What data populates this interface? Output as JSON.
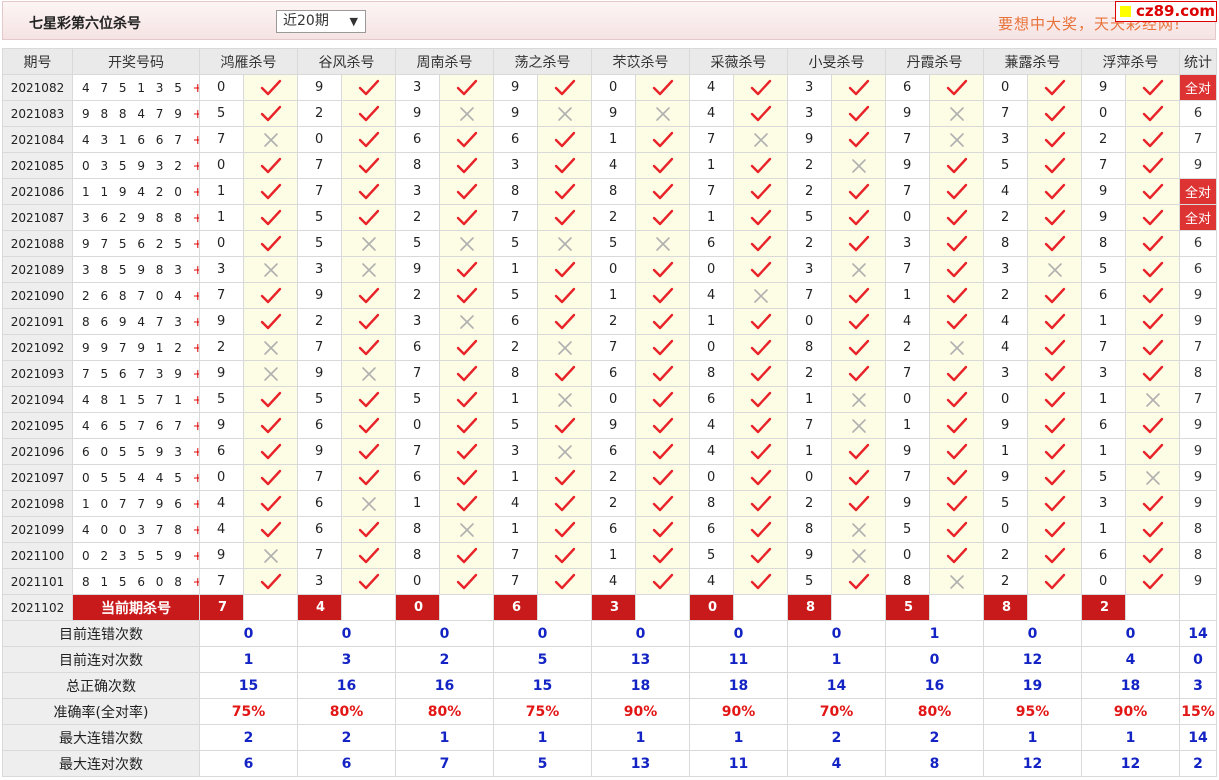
{
  "header": {
    "title": "七星彩第六位杀号",
    "period_select": "近20期",
    "slogan": "要想中大奖，天天彩经网!",
    "logo": "cz89.com"
  },
  "columns": {
    "period": "期号",
    "draw": "开奖号码",
    "experts": [
      "鸿雁杀号",
      "谷风杀号",
      "周南杀号",
      "荡之杀号",
      "芣苡杀号",
      "采薇杀号",
      "小旻杀号",
      "丹霞杀号",
      "蒹露杀号",
      "浮萍杀号"
    ],
    "stat": "统计"
  },
  "rows": [
    {
      "period": "2021082",
      "draw": "4 7 5 1 3 5",
      "plus": "+5",
      "kills": [
        0,
        9,
        3,
        9,
        0,
        4,
        3,
        6,
        0,
        9
      ],
      "ok": [
        1,
        1,
        1,
        1,
        1,
        1,
        1,
        1,
        1,
        1
      ],
      "stat": "全对"
    },
    {
      "period": "2021083",
      "draw": "9 8 8 4 7 9",
      "plus": "+13",
      "kills": [
        5,
        2,
        9,
        9,
        9,
        4,
        3,
        9,
        7,
        0
      ],
      "ok": [
        1,
        1,
        0,
        0,
        0,
        1,
        1,
        0,
        1,
        1
      ],
      "stat": "6"
    },
    {
      "period": "2021084",
      "draw": "4 3 1 6 6 7",
      "plus": "+0",
      "kills": [
        7,
        0,
        6,
        6,
        1,
        7,
        9,
        7,
        3,
        2
      ],
      "ok": [
        0,
        1,
        1,
        1,
        1,
        0,
        1,
        0,
        1,
        1
      ],
      "stat": "7"
    },
    {
      "period": "2021085",
      "draw": "0 3 5 9 3 2",
      "plus": "+7",
      "kills": [
        0,
        7,
        8,
        3,
        4,
        1,
        2,
        9,
        5,
        7
      ],
      "ok": [
        1,
        1,
        1,
        1,
        1,
        1,
        0,
        1,
        1,
        1
      ],
      "stat": "9"
    },
    {
      "period": "2021086",
      "draw": "1 1 9 4 2 0",
      "plus": "+0",
      "kills": [
        1,
        7,
        3,
        8,
        8,
        7,
        2,
        7,
        4,
        9
      ],
      "ok": [
        1,
        1,
        1,
        1,
        1,
        1,
        1,
        1,
        1,
        1
      ],
      "stat": "全对"
    },
    {
      "period": "2021087",
      "draw": "3 6 2 9 8 8",
      "plus": "+3",
      "kills": [
        1,
        5,
        2,
        7,
        2,
        1,
        5,
        0,
        2,
        9
      ],
      "ok": [
        1,
        1,
        1,
        1,
        1,
        1,
        1,
        1,
        1,
        1
      ],
      "stat": "全对"
    },
    {
      "period": "2021088",
      "draw": "9 7 5 6 2 5",
      "plus": "+5",
      "kills": [
        0,
        5,
        5,
        5,
        5,
        6,
        2,
        3,
        8,
        8
      ],
      "ok": [
        1,
        0,
        0,
        0,
        0,
        1,
        1,
        1,
        1,
        1
      ],
      "stat": "6"
    },
    {
      "period": "2021089",
      "draw": "3 8 5 9 8 3",
      "plus": "+10",
      "kills": [
        3,
        3,
        9,
        1,
        0,
        0,
        3,
        7,
        3,
        5
      ],
      "ok": [
        0,
        0,
        1,
        1,
        1,
        1,
        0,
        1,
        0,
        1
      ],
      "stat": "6"
    },
    {
      "period": "2021090",
      "draw": "2 6 8 7 0 4",
      "plus": "+6",
      "kills": [
        7,
        9,
        2,
        5,
        1,
        4,
        7,
        1,
        2,
        6
      ],
      "ok": [
        1,
        1,
        1,
        1,
        1,
        0,
        1,
        1,
        1,
        1
      ],
      "stat": "9"
    },
    {
      "period": "2021091",
      "draw": "8 6 9 4 7 3",
      "plus": "+5",
      "kills": [
        9,
        2,
        3,
        6,
        2,
        1,
        0,
        4,
        4,
        1
      ],
      "ok": [
        1,
        1,
        0,
        1,
        1,
        1,
        1,
        1,
        1,
        1
      ],
      "stat": "9"
    },
    {
      "period": "2021092",
      "draw": "9 9 7 9 1 2",
      "plus": "+14",
      "kills": [
        2,
        7,
        6,
        2,
        7,
        0,
        8,
        2,
        4,
        7
      ],
      "ok": [
        0,
        1,
        1,
        0,
        1,
        1,
        1,
        0,
        1,
        1
      ],
      "stat": "7"
    },
    {
      "period": "2021093",
      "draw": "7 5 6 7 3 9",
      "plus": "+8",
      "kills": [
        9,
        9,
        7,
        8,
        6,
        8,
        2,
        7,
        3,
        3
      ],
      "ok": [
        0,
        0,
        1,
        1,
        1,
        1,
        1,
        1,
        1,
        1
      ],
      "stat": "8"
    },
    {
      "period": "2021094",
      "draw": "4 8 1 5 7 1",
      "plus": "+1",
      "kills": [
        5,
        5,
        5,
        1,
        0,
        6,
        1,
        0,
        0,
        1
      ],
      "ok": [
        1,
        1,
        1,
        0,
        1,
        1,
        0,
        1,
        1,
        0
      ],
      "stat": "7"
    },
    {
      "period": "2021095",
      "draw": "4 6 5 7 6 7",
      "plus": "+6",
      "kills": [
        9,
        6,
        0,
        5,
        9,
        4,
        7,
        1,
        9,
        6
      ],
      "ok": [
        1,
        1,
        1,
        1,
        1,
        1,
        0,
        1,
        1,
        1
      ],
      "stat": "9"
    },
    {
      "period": "2021096",
      "draw": "6 0 5 5 9 3",
      "plus": "+13",
      "kills": [
        6,
        9,
        7,
        3,
        6,
        4,
        1,
        9,
        1,
        1
      ],
      "ok": [
        1,
        1,
        1,
        0,
        1,
        1,
        1,
        1,
        1,
        1
      ],
      "stat": "9"
    },
    {
      "period": "2021097",
      "draw": "0 5 5 4 4 5",
      "plus": "+0",
      "kills": [
        0,
        7,
        6,
        1,
        2,
        0,
        0,
        7,
        9,
        5
      ],
      "ok": [
        1,
        1,
        1,
        1,
        1,
        1,
        1,
        1,
        1,
        0
      ],
      "stat": "9"
    },
    {
      "period": "2021098",
      "draw": "1 0 7 7 9 6",
      "plus": "+5",
      "kills": [
        4,
        6,
        1,
        4,
        2,
        8,
        2,
        9,
        5,
        3
      ],
      "ok": [
        1,
        0,
        1,
        1,
        1,
        1,
        1,
        1,
        1,
        1
      ],
      "stat": "9"
    },
    {
      "period": "2021099",
      "draw": "4 0 0 3 7 8",
      "plus": "+7",
      "kills": [
        4,
        6,
        8,
        1,
        6,
        6,
        8,
        5,
        0,
        1
      ],
      "ok": [
        1,
        1,
        0,
        1,
        1,
        1,
        0,
        1,
        1,
        1
      ],
      "stat": "8"
    },
    {
      "period": "2021100",
      "draw": "0 2 3 5 5 9",
      "plus": "+14",
      "kills": [
        9,
        7,
        8,
        7,
        1,
        5,
        9,
        0,
        2,
        6
      ],
      "ok": [
        0,
        1,
        1,
        1,
        1,
        1,
        0,
        1,
        1,
        1
      ],
      "stat": "8"
    },
    {
      "period": "2021101",
      "draw": "8 1 5 6 0 8",
      "plus": "+10",
      "kills": [
        7,
        3,
        0,
        7,
        4,
        4,
        5,
        8,
        2,
        0
      ],
      "ok": [
        1,
        1,
        1,
        1,
        1,
        1,
        1,
        0,
        1,
        1
      ],
      "stat": "9"
    }
  ],
  "current": {
    "period": "2021102",
    "label": "当前期杀号",
    "kills": [
      "7",
      "4",
      "0",
      "6",
      "3",
      "0",
      "8",
      "5",
      "8",
      "2"
    ]
  },
  "summary": [
    {
      "label": "目前连错次数",
      "values": [
        "0",
        "0",
        "0",
        "0",
        "0",
        "0",
        "0",
        "1",
        "0",
        "0"
      ],
      "stat": "14",
      "color": "blue"
    },
    {
      "label": "目前连对次数",
      "values": [
        "1",
        "3",
        "2",
        "5",
        "13",
        "11",
        "1",
        "0",
        "12",
        "4"
      ],
      "stat": "0",
      "color": "blue"
    },
    {
      "label": "总正确次数",
      "values": [
        "15",
        "16",
        "16",
        "15",
        "18",
        "18",
        "14",
        "16",
        "19",
        "18"
      ],
      "stat": "3",
      "color": "blue"
    },
    {
      "label": "准确率(全对率)",
      "values": [
        "75%",
        "80%",
        "80%",
        "75%",
        "90%",
        "90%",
        "70%",
        "80%",
        "95%",
        "90%"
      ],
      "stat": "15%",
      "color": "red"
    },
    {
      "label": "最大连错次数",
      "values": [
        "2",
        "2",
        "1",
        "1",
        "1",
        "1",
        "2",
        "2",
        "1",
        "1"
      ],
      "stat": "14",
      "color": "blue"
    },
    {
      "label": "最大连对次数",
      "values": [
        "6",
        "6",
        "7",
        "5",
        "13",
        "11",
        "4",
        "8",
        "12",
        "12"
      ],
      "stat": "2",
      "color": "blue"
    }
  ],
  "marks": {
    "ok_icon": "check-icon",
    "fail_icon": "cross-icon",
    "ok_color": "#e8232a",
    "fail_color": "#b0b0b0",
    "accent": "#c8191b"
  }
}
